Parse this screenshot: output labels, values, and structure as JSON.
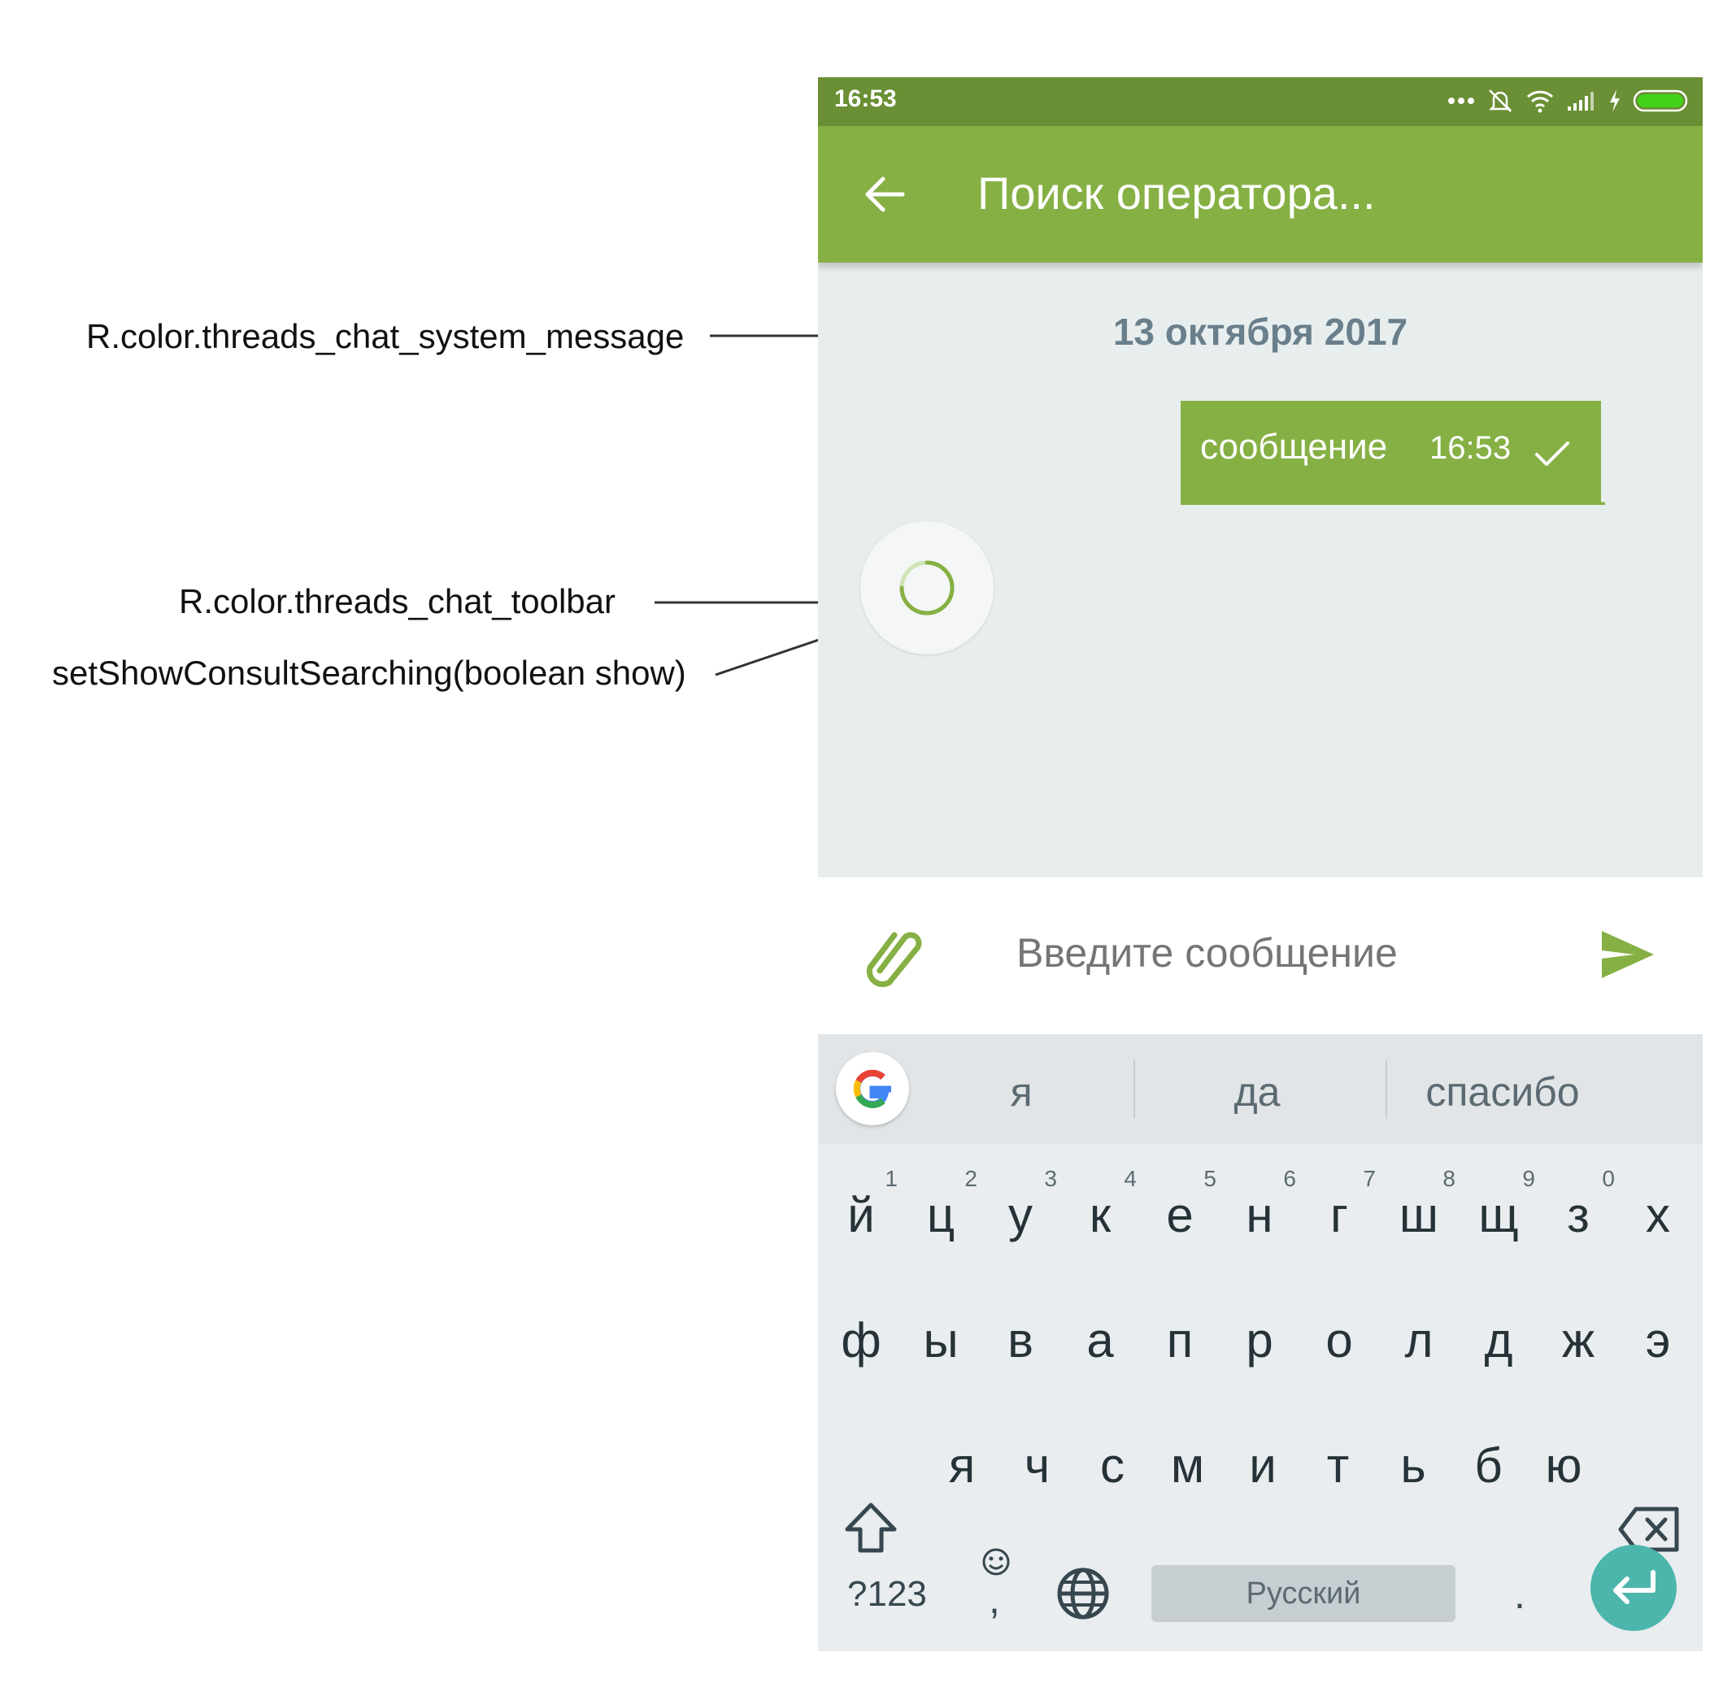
{
  "annotations": {
    "system_message": "R.color.threads_chat_system_message",
    "toolbar_color": "R.color.threads_chat_toolbar",
    "consult_searching": "setShowConsultSearching(boolean show)"
  },
  "statusbar": {
    "time": "16:53"
  },
  "toolbar": {
    "title": "Поиск оператора..."
  },
  "chat": {
    "date": "13 октября 2017",
    "message": {
      "text": "сообщение",
      "time": "16:53"
    }
  },
  "input": {
    "placeholder": "Введите сообщение"
  },
  "keyboard": {
    "suggestions": [
      "я",
      "да",
      "спасибо"
    ],
    "row1": [
      {
        "ch": "й",
        "num": "1"
      },
      {
        "ch": "ц",
        "num": "2"
      },
      {
        "ch": "у",
        "num": "3"
      },
      {
        "ch": "к",
        "num": "4"
      },
      {
        "ch": "е",
        "num": "5"
      },
      {
        "ch": "н",
        "num": "6"
      },
      {
        "ch": "г",
        "num": "7"
      },
      {
        "ch": "ш",
        "num": "8"
      },
      {
        "ch": "щ",
        "num": "9"
      },
      {
        "ch": "з",
        "num": "0"
      },
      {
        "ch": "х",
        "num": ""
      }
    ],
    "row2": [
      "ф",
      "ы",
      "в",
      "а",
      "п",
      "р",
      "о",
      "л",
      "д",
      "ж",
      "э"
    ],
    "row3": [
      "я",
      "ч",
      "с",
      "м",
      "и",
      "т",
      "ь",
      "б",
      "ю"
    ],
    "symbols_label": "?123",
    "comma_label": ",",
    "space_label": "Русский",
    "period_label": "."
  },
  "colors": {
    "statusbar": "#6a8f34",
    "toolbar": "#86b044",
    "chat_background": "#e8eeee",
    "system_message": "#6a7f8c",
    "enter_key": "#4db6ac"
  }
}
